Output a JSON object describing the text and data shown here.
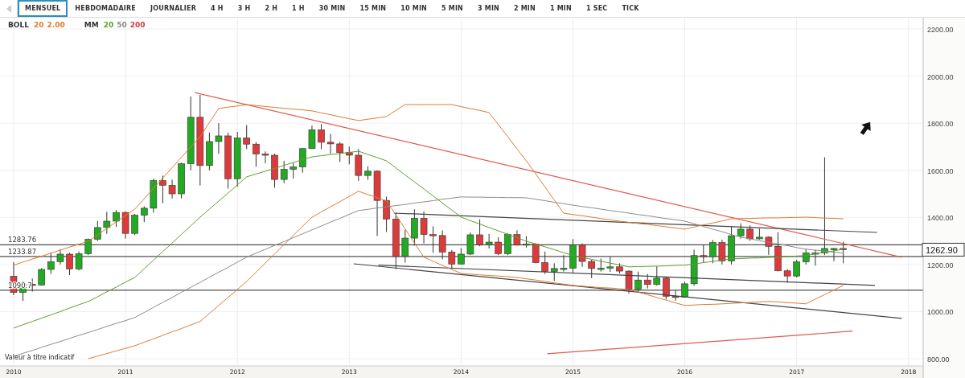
{
  "tabs": [
    {
      "label": "MENSUEL",
      "selected": true
    },
    {
      "label": "HEBDOMADAIRE",
      "selected": false
    },
    {
      "label": "JOURNALIER",
      "selected": false
    },
    {
      "label": "4 H",
      "selected": false
    },
    {
      "label": "3 H",
      "selected": false
    },
    {
      "label": "2 H",
      "selected": false
    },
    {
      "label": "1 H",
      "selected": false
    },
    {
      "label": "30 MIN",
      "selected": false
    },
    {
      "label": "15 MIN",
      "selected": false
    },
    {
      "label": "10 MIN",
      "selected": false
    },
    {
      "label": "5 MIN",
      "selected": false
    },
    {
      "label": "3 MIN",
      "selected": false
    },
    {
      "label": "2 MIN",
      "selected": false
    },
    {
      "label": "1 MIN",
      "selected": false
    },
    {
      "label": "1 SEC",
      "selected": false
    },
    {
      "label": "TICK",
      "selected": false
    }
  ],
  "legend": [
    {
      "label": "BOLL",
      "params": [
        {
          "text": "20",
          "color": "#e07b2e"
        },
        {
          "text": "2.00",
          "color": "#e07b2e"
        }
      ]
    },
    {
      "label": "MM",
      "params": [
        {
          "text": "20",
          "color": "#5aa02c"
        },
        {
          "text": "50",
          "color": "#8c8c8c"
        },
        {
          "text": "200",
          "color": "#d43c3c"
        }
      ]
    }
  ],
  "chart": {
    "note": "Valeur à titre indicatif",
    "last_price": "1262.90",
    "chart_data": {
      "type": "candlestick",
      "grid": true,
      "xlim": [
        2009.878,
        2018.131
      ],
      "ylim": [
        800,
        2200
      ],
      "ref_lines": [
        {
          "axis": "y",
          "value": 1283.76,
          "label": "1283.76"
        },
        {
          "axis": "y",
          "value": 1233.87,
          "label": "1233.87"
        },
        {
          "axis": "y",
          "value": 1090.7,
          "label": "1090.7"
        }
      ],
      "yticks": [
        {
          "value": 800,
          "label": "800.00"
        },
        {
          "value": 1000,
          "label": "1000.00"
        },
        {
          "value": 1200,
          "label": "1200.00"
        },
        {
          "value": 1400,
          "label": "1400.00"
        },
        {
          "value": 1600,
          "label": "1600.00"
        },
        {
          "value": 1800,
          "label": "1800.00"
        },
        {
          "value": 2000,
          "label": "2000.00"
        },
        {
          "value": 2200,
          "label": "2200.00"
        }
      ],
      "xticks": [
        {
          "value": 2010,
          "label": "2010"
        },
        {
          "value": 2011,
          "label": "2011"
        },
        {
          "value": 2012,
          "label": "2012"
        },
        {
          "value": 2013,
          "label": "2013"
        },
        {
          "value": 2014,
          "label": "2014"
        },
        {
          "value": 2015,
          "label": "2015"
        },
        {
          "value": 2016,
          "label": "2016"
        },
        {
          "value": 2017,
          "label": "2017"
        },
        {
          "value": 2018,
          "label": "2018"
        }
      ],
      "x": [
        2010,
        2010.083,
        2010.167,
        2010.25,
        2010.333,
        2010.417,
        2010.5,
        2010.583,
        2010.667,
        2010.75,
        2010.833,
        2010.917,
        2011,
        2011.083,
        2011.167,
        2011.25,
        2011.333,
        2011.417,
        2011.5,
        2011.583,
        2011.667,
        2011.75,
        2011.833,
        2011.917,
        2012,
        2012.083,
        2012.167,
        2012.25,
        2012.333,
        2012.417,
        2012.5,
        2012.583,
        2012.667,
        2012.75,
        2012.833,
        2012.917,
        2013,
        2013.083,
        2013.167,
        2013.25,
        2013.333,
        2013.417,
        2013.5,
        2013.583,
        2013.667,
        2013.75,
        2013.833,
        2013.917,
        2014,
        2014.083,
        2014.167,
        2014.25,
        2014.333,
        2014.417,
        2014.5,
        2014.583,
        2014.667,
        2014.75,
        2014.833,
        2014.917,
        2015,
        2015.083,
        2015.167,
        2015.25,
        2015.333,
        2015.417,
        2015.5,
        2015.583,
        2015.667,
        2015.75,
        2015.833,
        2015.917,
        2016,
        2016.083,
        2016.167,
        2016.25,
        2016.333,
        2016.417,
        2016.5,
        2016.583,
        2016.667,
        2016.75,
        2016.833,
        2016.917,
        2017,
        2017.083,
        2017.167,
        2017.25,
        2017.333,
        2017.417
      ],
      "series": [
        {
          "ohlc": [
            [
              1150,
              1210,
              1070,
              1081
            ],
            [
              1081,
              1130,
              1045,
              1116
            ],
            [
              1116,
              1140,
              1085,
              1113
            ],
            [
              1113,
              1185,
              1110,
              1179
            ],
            [
              1179,
              1250,
              1160,
              1212
            ],
            [
              1212,
              1265,
              1200,
              1244
            ],
            [
              1244,
              1250,
              1155,
              1181
            ],
            [
              1181,
              1255,
              1175,
              1246
            ],
            [
              1246,
              1310,
              1240,
              1307
            ],
            [
              1307,
              1385,
              1300,
              1357
            ],
            [
              1357,
              1424,
              1330,
              1384
            ],
            [
              1384,
              1431,
              1360,
              1421
            ],
            [
              1421,
              1425,
              1310,
              1332
            ],
            [
              1332,
              1415,
              1325,
              1409
            ],
            [
              1409,
              1447,
              1380,
              1439
            ],
            [
              1439,
              1565,
              1420,
              1556
            ],
            [
              1556,
              1577,
              1460,
              1536
            ],
            [
              1536,
              1560,
              1480,
              1500
            ],
            [
              1500,
              1632,
              1480,
              1628
            ],
            [
              1628,
              1913,
              1600,
              1825
            ],
            [
              1825,
              1920,
              1535,
              1620
            ],
            [
              1620,
              1760,
              1600,
              1722
            ],
            [
              1722,
              1800,
              1670,
              1746
            ],
            [
              1746,
              1760,
              1522,
              1564
            ],
            [
              1564,
              1763,
              1530,
              1737
            ],
            [
              1737,
              1792,
              1690,
              1711
            ],
            [
              1711,
              1720,
              1615,
              1669
            ],
            [
              1669,
              1680,
              1630,
              1664
            ],
            [
              1664,
              1670,
              1526,
              1561
            ],
            [
              1561,
              1640,
              1545,
              1604
            ],
            [
              1604,
              1630,
              1565,
              1614
            ],
            [
              1614,
              1694,
              1590,
              1692
            ],
            [
              1692,
              1790,
              1690,
              1772
            ],
            [
              1772,
              1796,
              1690,
              1719
            ],
            [
              1719,
              1755,
              1670,
              1712
            ],
            [
              1712,
              1720,
              1635,
              1675
            ],
            [
              1675,
              1700,
              1625,
              1664
            ],
            [
              1664,
              1690,
              1555,
              1578
            ],
            [
              1578,
              1617,
              1560,
              1596
            ],
            [
              1596,
              1600,
              1321,
              1472
            ],
            [
              1472,
              1488,
              1338,
              1393
            ],
            [
              1393,
              1420,
              1180,
              1234
            ],
            [
              1234,
              1348,
              1208,
              1312
            ],
            [
              1312,
              1434,
              1280,
              1396
            ],
            [
              1396,
              1425,
              1290,
              1327
            ],
            [
              1327,
              1362,
              1250,
              1323
            ],
            [
              1323,
              1345,
              1222,
              1253
            ],
            [
              1253,
              1262,
              1182,
              1202
            ],
            [
              1202,
              1270,
              1200,
              1244
            ],
            [
              1244,
              1336,
              1240,
              1326
            ],
            [
              1326,
              1392,
              1277,
              1284
            ],
            [
              1284,
              1330,
              1268,
              1295
            ],
            [
              1295,
              1315,
              1240,
              1246
            ],
            [
              1246,
              1332,
              1240,
              1327
            ],
            [
              1327,
              1345,
              1280,
              1282
            ],
            [
              1282,
              1320,
              1272,
              1287
            ],
            [
              1287,
              1290,
              1205,
              1208
            ],
            [
              1208,
              1255,
              1160,
              1171
            ],
            [
              1171,
              1205,
              1130,
              1183
            ],
            [
              1183,
              1240,
              1170,
              1184
            ],
            [
              1184,
              1308,
              1165,
              1283
            ],
            [
              1283,
              1290,
              1190,
              1213
            ],
            [
              1213,
              1220,
              1142,
              1183
            ],
            [
              1183,
              1225,
              1170,
              1184
            ],
            [
              1184,
              1233,
              1169,
              1190
            ],
            [
              1190,
              1205,
              1162,
              1172
            ],
            [
              1172,
              1175,
              1077,
              1095
            ],
            [
              1095,
              1170,
              1080,
              1134
            ],
            [
              1134,
              1160,
              1098,
              1115
            ],
            [
              1115,
              1192,
              1110,
              1142
            ],
            [
              1142,
              1145,
              1052,
              1065
            ],
            [
              1065,
              1090,
              1046,
              1061
            ],
            [
              1061,
              1127,
              1060,
              1118
            ],
            [
              1118,
              1263,
              1110,
              1238
            ],
            [
              1238,
              1284,
              1208,
              1233
            ],
            [
              1233,
              1304,
              1205,
              1293
            ],
            [
              1293,
              1305,
              1200,
              1215
            ],
            [
              1215,
              1362,
              1200,
              1322
            ],
            [
              1322,
              1375,
              1310,
              1350
            ],
            [
              1350,
              1366,
              1300,
              1309
            ],
            [
              1309,
              1352,
              1305,
              1316
            ],
            [
              1316,
              1320,
              1241,
              1277
            ],
            [
              1277,
              1337,
              1171,
              1173
            ],
            [
              1173,
              1180,
              1122,
              1151
            ],
            [
              1151,
              1220,
              1145,
              1211
            ],
            [
              1211,
              1264,
              1200,
              1249
            ],
            [
              1249,
              1262,
              1195,
              1249
            ],
            [
              1249,
              1655,
              1240,
              1268
            ],
            [
              1268,
              1270,
              1214,
              1268
            ],
            [
              1268,
              1296,
              1205,
              1262.9
            ]
          ]
        },
        {
          "type": "line",
          "color": "#e05a4a",
          "x": [
            2011.62,
            2017.94
          ],
          "values": [
            1930,
            1231
          ]
        },
        {
          "type": "line",
          "color": "#444444",
          "x": [
            2013.4,
            2017.72
          ],
          "values": [
            1418,
            1336
          ]
        },
        {
          "type": "line",
          "color": "#444444",
          "x": [
            2013.26,
            2017.7
          ],
          "values": [
            1197,
            1111
          ]
        },
        {
          "type": "line",
          "color": "#444444",
          "x": [
            2013.04,
            2017.94
          ],
          "values": [
            1203,
            971
          ]
        },
        {
          "type": "line",
          "color": "#e05a4a",
          "x": [
            2014.77,
            2017.5
          ],
          "values": [
            821,
            917
          ]
        },
        {
          "type": "line",
          "color": "#e07b2e",
          "values": [
            1197,
            1210,
            1223,
            1235,
            1248,
            1261,
            1274,
            1286,
            1299,
            1326,
            1353,
            1381,
            1408,
            1435,
            1479,
            1523,
            1567,
            1611,
            1655,
            1699,
            1743,
            1803,
            1862,
            1868,
            1873,
            1879,
            1875,
            1871,
            1867,
            1863,
            1860,
            1856,
            1852,
            1844,
            1836,
            1827,
            1819,
            1811,
            1817,
            1822,
            1828,
            1854,
            1879,
            1879,
            1879,
            1879,
            1879,
            1879,
            1870,
            1862,
            1854,
            1845,
            1794,
            1743,
            1691,
            1640,
            1585,
            1529,
            1474,
            1418,
            1412,
            1407,
            1401,
            1395,
            1390,
            1384,
            1379,
            1374,
            1370,
            1365,
            1360,
            1355,
            1350,
            1359,
            1368,
            1376,
            1385,
            1394,
            1395,
            1396,
            1397,
            1398,
            1398,
            1399,
            1400,
            1401,
            1399,
            1397,
            1396,
            1394
          ]
        },
        {
          "type": "line",
          "color": "#e07b2e",
          "values": [
            null,
            null,
            null,
            null,
            null,
            null,
            null,
            null,
            800,
            811,
            822,
            833,
            844,
            855,
            870,
            884,
            899,
            914,
            928,
            943,
            958,
            992,
            1026,
            1060,
            1094,
            1128,
            1167,
            1206,
            1245,
            1284,
            1323,
            1362,
            1401,
            1423,
            1445,
            1467,
            1489,
            1511,
            1497,
            1484,
            1470,
            1410,
            1351,
            1291,
            1231,
            1214,
            1196,
            1179,
            1162,
            1159,
            1156,
            1153,
            1151,
            1148,
            1145,
            1139,
            1134,
            1128,
            1122,
            1117,
            1111,
            1108,
            1105,
            1102,
            1100,
            1097,
            1094,
            1083,
            1071,
            1060,
            1049,
            1037,
            1026,
            1028,
            1030,
            1031,
            1033,
            1035,
            1037,
            1039,
            1041,
            1043,
            1041,
            1038,
            1036,
            1033,
            1053,
            1072,
            1092,
            1111
          ]
        },
        {
          "type": "line",
          "color": "#5aa02c",
          "values": [
            930,
            944,
            958,
            972,
            986,
            1000,
            1015,
            1029,
            1043,
            1063,
            1084,
            1104,
            1125,
            1145,
            1182,
            1218,
            1255,
            1291,
            1328,
            1364,
            1401,
            1435,
            1469,
            1503,
            1538,
            1572,
            1584,
            1596,
            1608,
            1621,
            1633,
            1645,
            1657,
            1662,
            1667,
            1671,
            1676,
            1681,
            1667,
            1654,
            1640,
            1610,
            1580,
            1551,
            1521,
            1491,
            1461,
            1431,
            1401,
            1386,
            1372,
            1357,
            1343,
            1328,
            1314,
            1299,
            1287,
            1275,
            1263,
            1250,
            1238,
            1230,
            1222,
            1214,
            1206,
            1198,
            1190,
            1191,
            1192,
            1193,
            1194,
            1196,
            1197,
            1202,
            1208,
            1213,
            1219,
            1224,
            1225,
            1227,
            1228,
            1230,
            1231,
            1233,
            1236,
            1238,
            1245,
            1252,
            1258,
            1265
          ]
        },
        {
          "type": "line",
          "color": "#8c8c8c",
          "values": [
            810,
            823,
            835,
            848,
            861,
            873,
            886,
            899,
            911,
            924,
            937,
            950,
            962,
            975,
            996,
            1018,
            1039,
            1060,
            1082,
            1103,
            1124,
            1146,
            1167,
            1188,
            1210,
            1231,
            1248,
            1264,
            1281,
            1297,
            1314,
            1330,
            1347,
            1363,
            1380,
            1396,
            1413,
            1429,
            1434,
            1440,
            1445,
            1450,
            1455,
            1461,
            1466,
            1471,
            1477,
            1482,
            1487,
            1486,
            1486,
            1485,
            1485,
            1484,
            1484,
            1483,
            1477,
            1471,
            1464,
            1458,
            1452,
            1446,
            1441,
            1435,
            1429,
            1424,
            1418,
            1412,
            1407,
            1401,
            1395,
            1390,
            1384,
            1373,
            1361,
            1350,
            1339,
            1327,
            1316,
            1309,
            1301,
            1294,
            1287,
            1280,
            1272,
            1265,
            1261,
            1257,
            1252,
            1248
          ]
        }
      ]
    }
  }
}
